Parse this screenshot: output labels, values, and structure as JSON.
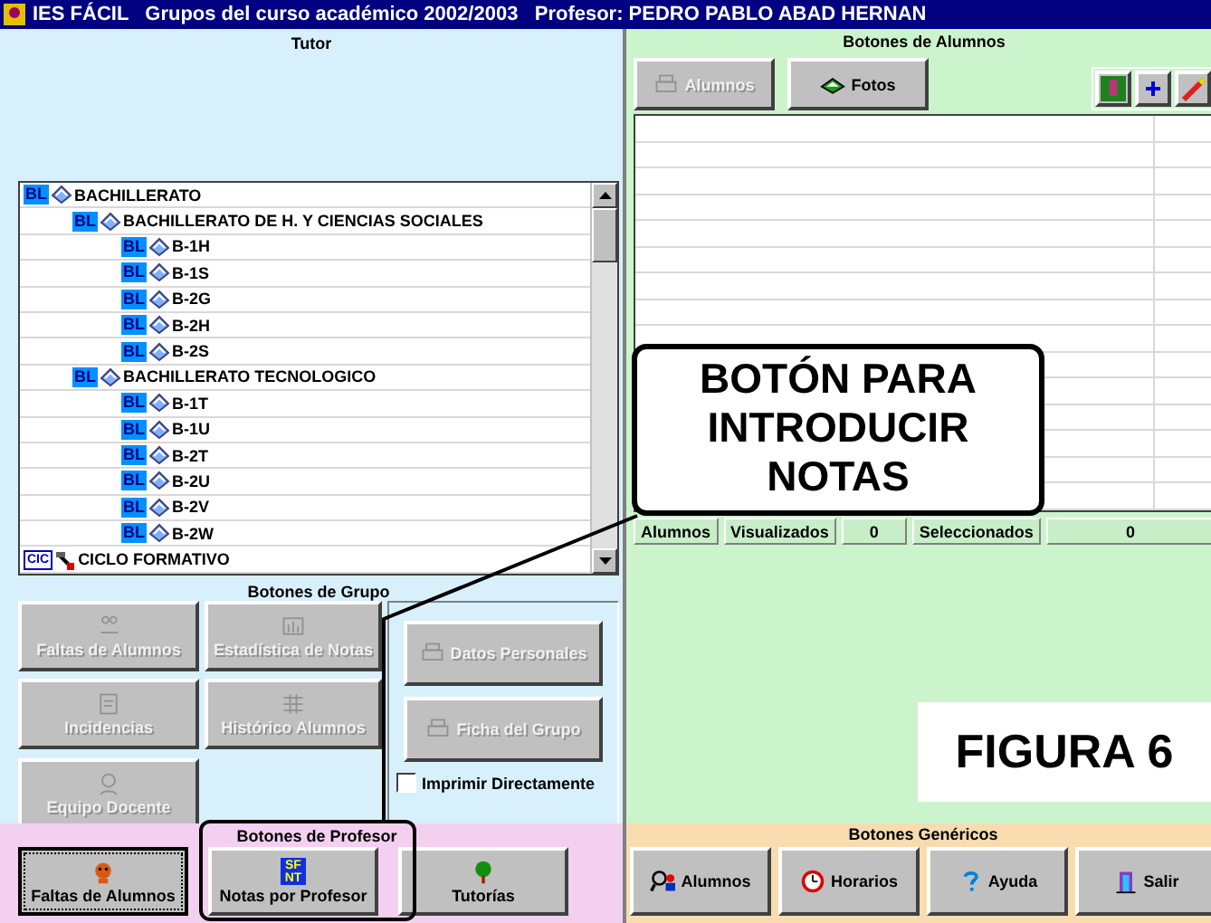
{
  "window": {
    "title": "IES FÁCIL   Grupos del curso académico 2002/2003   Profesor: PEDRO PABLO ABAD HERNAN"
  },
  "tutor_panel": {
    "title": "Tutor"
  },
  "tree": [
    {
      "kind": "bl",
      "badge": "BL",
      "label": "BACHILLERATO",
      "children": [
        {
          "kind": "bl",
          "badge": "BL",
          "label": "BACHILLERATO DE H. Y CIENCIAS SOCIALES",
          "children": [
            {
              "kind": "bl",
              "badge": "BL",
              "label": "B-1H"
            },
            {
              "kind": "bl",
              "badge": "BL",
              "label": "B-1S"
            },
            {
              "kind": "bl",
              "badge": "BL",
              "label": "B-2G"
            },
            {
              "kind": "bl",
              "badge": "BL",
              "label": "B-2H"
            },
            {
              "kind": "bl",
              "badge": "BL",
              "label": "B-2S"
            }
          ]
        },
        {
          "kind": "bl",
          "badge": "BL",
          "label": "BACHILLERATO TECNOLOGICO",
          "children": [
            {
              "kind": "bl",
              "badge": "BL",
              "label": "B-1T"
            },
            {
              "kind": "bl",
              "badge": "BL",
              "label": "B-1U"
            },
            {
              "kind": "bl",
              "badge": "BL",
              "label": "B-2T"
            },
            {
              "kind": "bl",
              "badge": "BL",
              "label": "B-2U"
            },
            {
              "kind": "bl",
              "badge": "BL",
              "label": "B-2V"
            },
            {
              "kind": "bl",
              "badge": "BL",
              "label": "B-2W"
            }
          ]
        }
      ]
    },
    {
      "kind": "cic",
      "badge": "CIC",
      "label": "CICLO FORMATIVO"
    }
  ],
  "group_buttons": {
    "title": "Botones de Grupo",
    "buttons": [
      {
        "label": "Faltas de Alumnos",
        "disabled": true
      },
      {
        "label": "Estadística de Notas",
        "disabled": true
      },
      {
        "label": "Incidencias",
        "disabled": true
      },
      {
        "label": "Histórico Alumnos",
        "disabled": true
      },
      {
        "label": "Equipo Docente",
        "disabled": true
      }
    ],
    "side_buttons": [
      {
        "label": "Datos Personales",
        "disabled": true
      },
      {
        "label": "Ficha del Grupo",
        "disabled": true
      }
    ],
    "print_directly": {
      "label": "Imprimir Directamente",
      "checked": false
    }
  },
  "teacher_buttons": {
    "title": "Botones de Profesor",
    "buttons": [
      {
        "label": "Faltas de Alumnos",
        "focused": true
      },
      {
        "label": "Notas por Profesor",
        "badge_top": "SF",
        "badge_bottom": "NT",
        "focused": false
      },
      {
        "label": "Tutorías",
        "focused": false
      }
    ]
  },
  "student_buttons": {
    "title": "Botones de Alumnos",
    "buttons": [
      {
        "label": "Alumnos",
        "disabled": true
      },
      {
        "label": "Fotos",
        "disabled": false
      }
    ]
  },
  "status": [
    {
      "kind": "label",
      "text": "Alumnos"
    },
    {
      "kind": "label",
      "text": "Visualizados"
    },
    {
      "kind": "value",
      "text": "0"
    },
    {
      "kind": "label",
      "text": "Seleccionados"
    },
    {
      "kind": "value",
      "text": "0"
    }
  ],
  "generic_buttons": {
    "title": "Botones Genéricos",
    "buttons": [
      {
        "label": "Alumnos"
      },
      {
        "label": "Horarios"
      },
      {
        "label": "Ayuda"
      },
      {
        "label": "Salir"
      }
    ]
  },
  "callout": {
    "text": "BOTÓN PARA INTRODUCIR NOTAS"
  },
  "figure_label": "FIGURA 6"
}
